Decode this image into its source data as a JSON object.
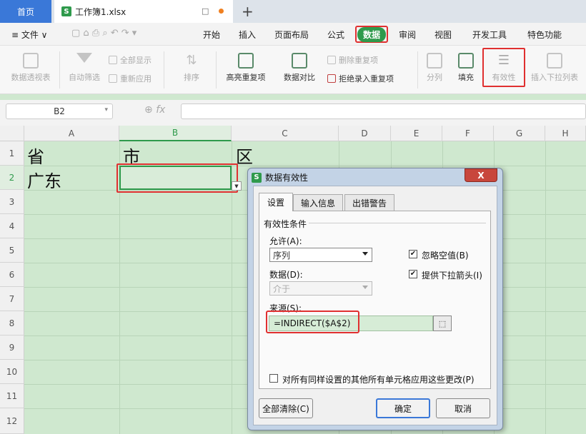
{
  "titlebar": {
    "home_tab": "首页",
    "file_tab": "工作簿1.xlsx",
    "file_icon": "S",
    "new_tab": "+",
    "monitor_icon": "□"
  },
  "menu": {
    "file": "≡ 文件 ∨",
    "items": [
      "开始",
      "插入",
      "页面布局",
      "公式",
      "数据",
      "审阅",
      "视图",
      "开发工具",
      "特色功能"
    ],
    "active": "数据"
  },
  "ribbon": {
    "pivot": "数据透视表",
    "autofilter": "自动筛选",
    "showall": "全部显示",
    "reapply": "重新应用",
    "sort": "排序",
    "highlight_dup": "高亮重复项",
    "compare": "数据对比",
    "remove_dup": "删除重复项",
    "reject_dup": "拒绝录入重复项",
    "split": "分列",
    "fill": "填充",
    "validity": "有效性",
    "insert_dropdown": "插入下拉列表"
  },
  "formula_bar": {
    "name_box": "B2",
    "fx": "fx",
    "content": ""
  },
  "columns": [
    "A",
    "B",
    "C",
    "D",
    "E",
    "F",
    "G",
    "H"
  ],
  "selected_column": "B",
  "rows": [
    "1",
    "2",
    "3",
    "4",
    "5",
    "6",
    "7",
    "8",
    "9",
    "10",
    "11",
    "12"
  ],
  "selected_row": "2",
  "cells": {
    "A1": "省",
    "B1": "市",
    "C1": "区",
    "A2": "广东"
  },
  "dialog": {
    "title": "数据有效性",
    "close": "X",
    "tabs": [
      "设置",
      "输入信息",
      "出错警告"
    ],
    "group": "有效性条件",
    "allow_label": "允许(A):",
    "allow_value": "序列",
    "data_label": "数据(D):",
    "data_value": "介于",
    "ignore_blank": "忽略空值(B)",
    "ignore_blank_checked": true,
    "dropdown_arrow": "提供下拉箭头(I)",
    "dropdown_arrow_checked": true,
    "source_label": "来源(S):",
    "source_value": "=INDIRECT($A$2)",
    "apply_all": "对所有同样设置的其他所有单元格应用这些更改(P)",
    "clear_all": "全部清除(C)",
    "ok": "确定",
    "cancel": "取消"
  },
  "colors": {
    "accent_green": "#2f9a4c",
    "highlight_red": "#e03030",
    "sheet_bg": "#cfe8cf"
  }
}
